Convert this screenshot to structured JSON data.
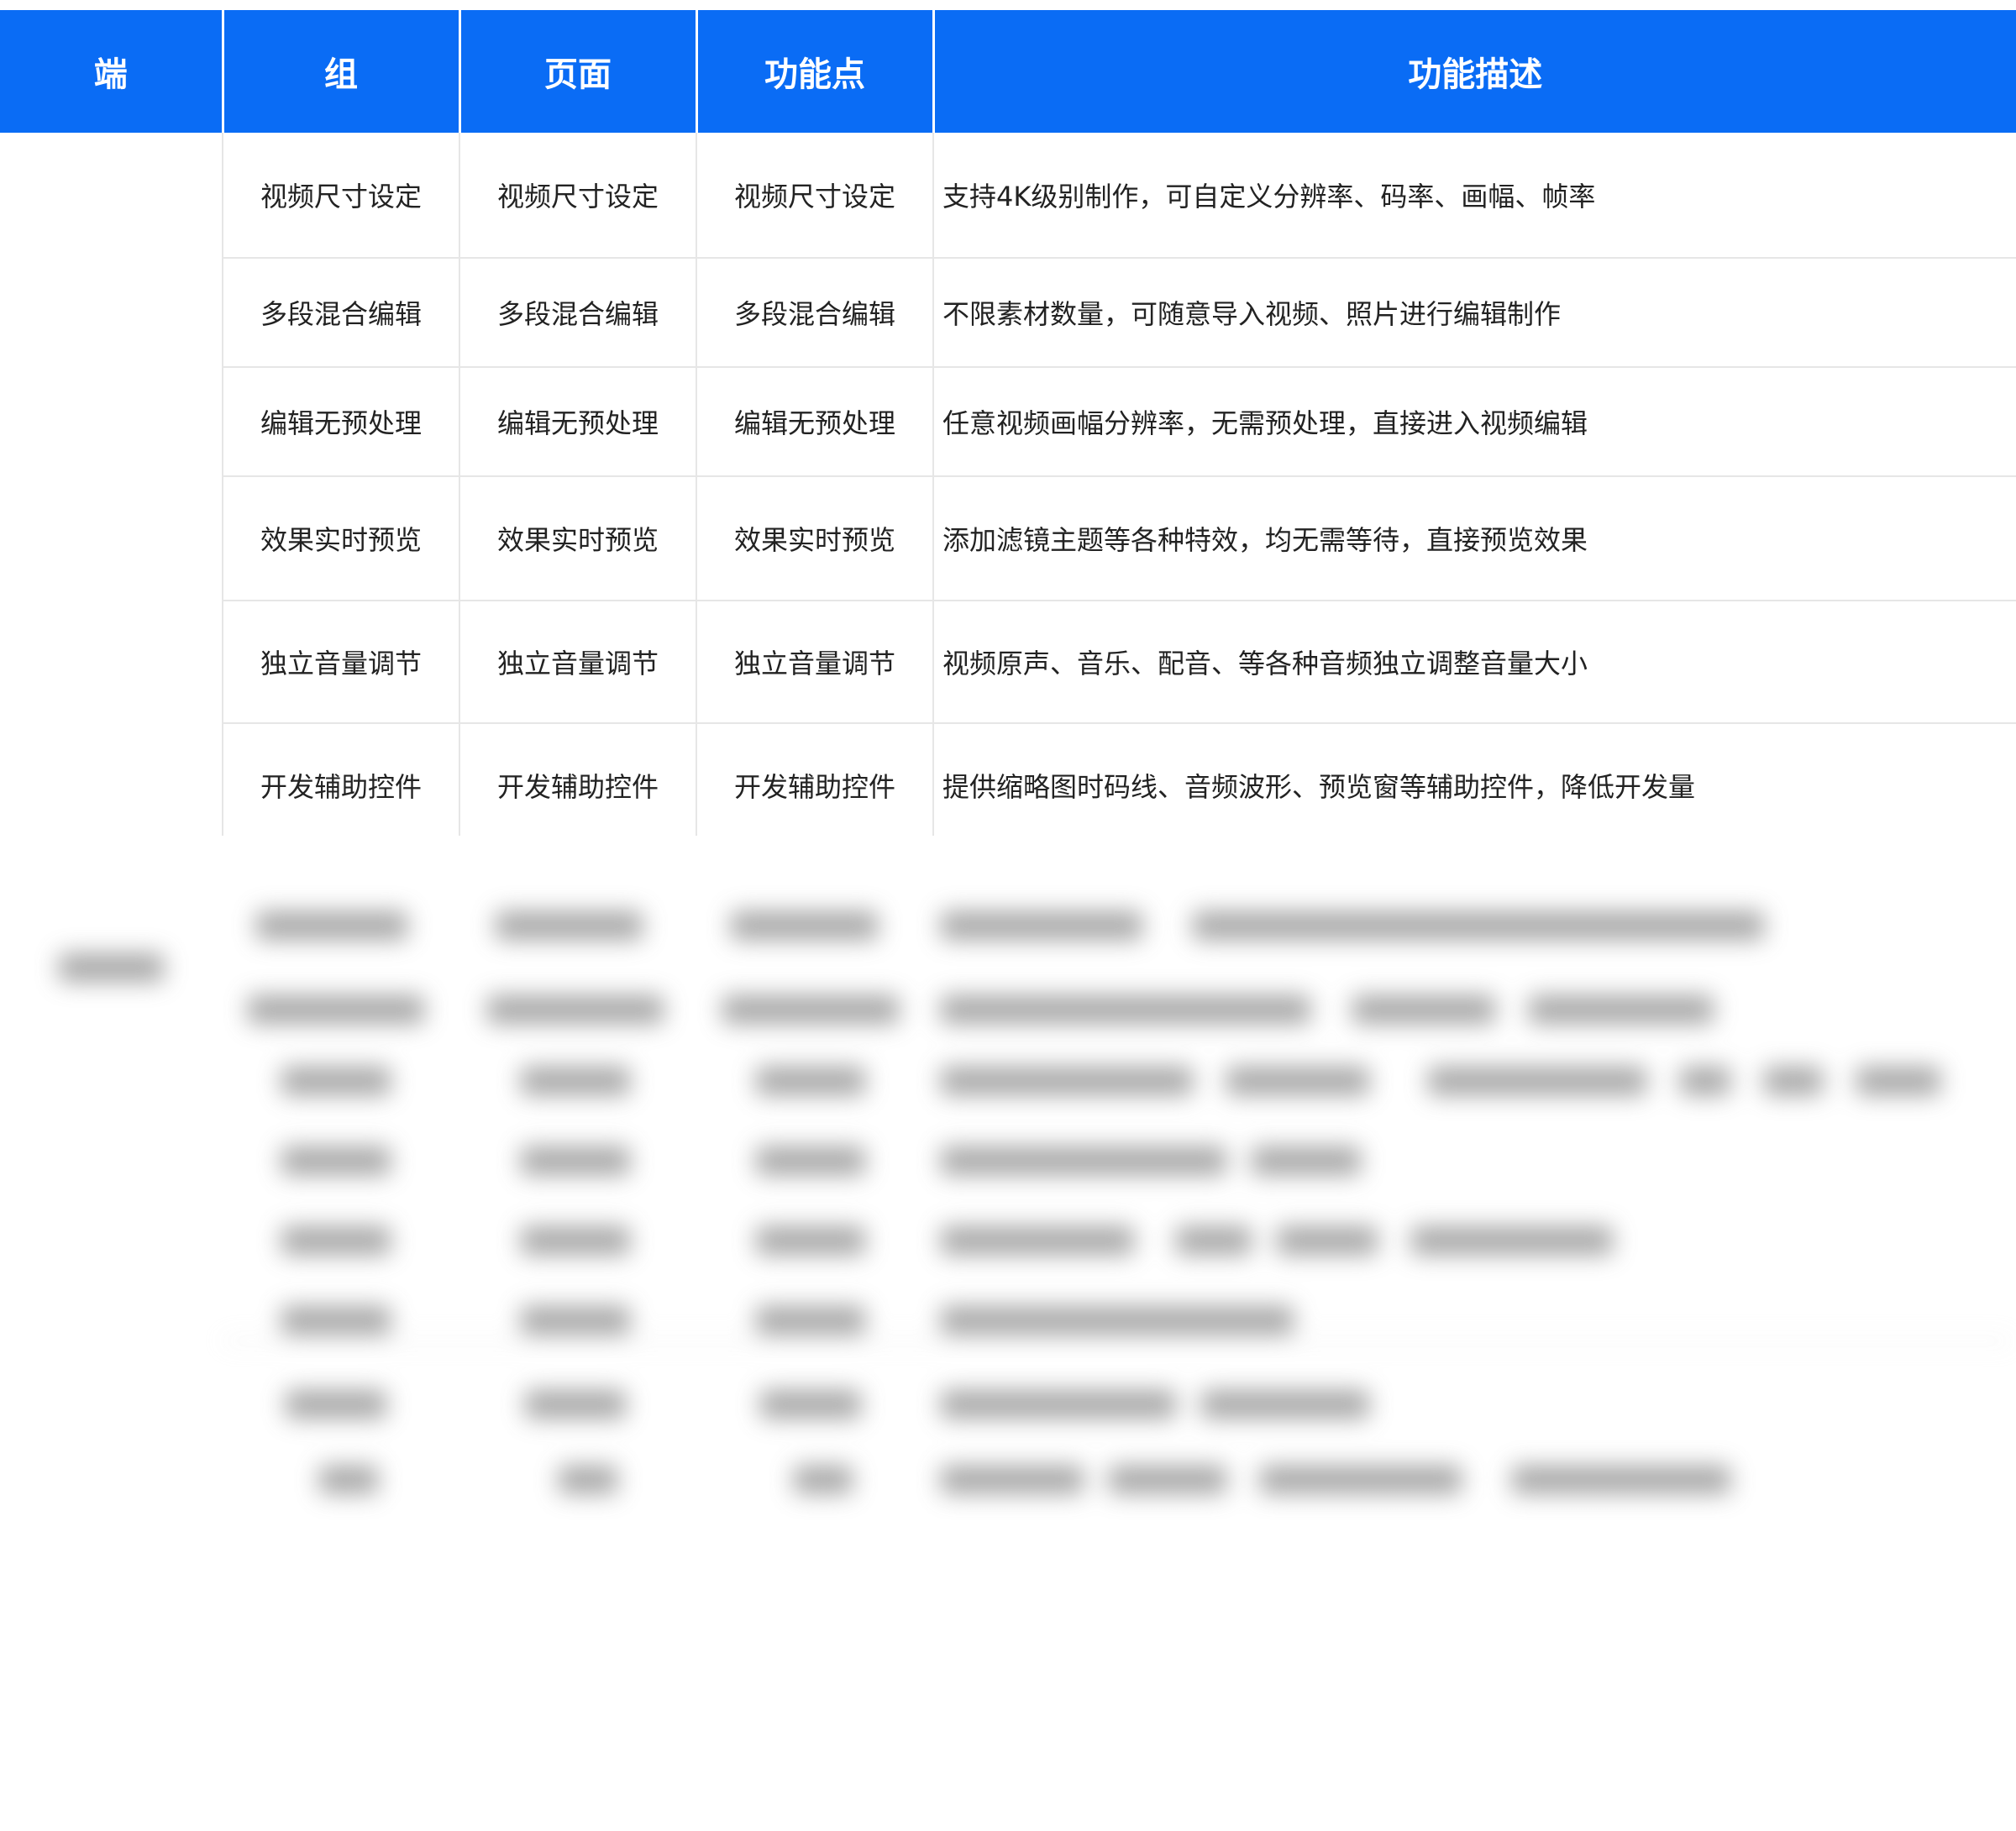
{
  "table": {
    "headers": {
      "duan": "端",
      "group": "组",
      "page": "页面",
      "feature": "功能点",
      "description": "功能描述"
    },
    "rows": [
      {
        "group": "视频尺寸设定",
        "page": "视频尺寸设定",
        "feature": "视频尺寸设定",
        "description": "支持4K级别制作，可自定义分辨率、码率、画幅、帧率"
      },
      {
        "group": "多段混合编辑",
        "page": "多段混合编辑",
        "feature": "多段混合编辑",
        "description": "不限素材数量，可随意导入视频、照片进行编辑制作"
      },
      {
        "group": "编辑无预处理",
        "page": "编辑无预处理",
        "feature": "编辑无预处理",
        "description": "任意视频画幅分辨率，无需预处理，直接进入视频编辑"
      },
      {
        "group": "效果实时预览",
        "page": "效果实时预览",
        "feature": "效果实时预览",
        "description": "添加滤镜主题等各种特效，均无需等待，直接预览效果"
      },
      {
        "group": "独立音量调节",
        "page": "独立音量调节",
        "feature": "独立音量调节",
        "description": "视频原声、音乐、配音、等各种音频独立调整音量大小"
      },
      {
        "group": "开发辅助控件",
        "page": "开发辅助控件",
        "feature": "开发辅助控件",
        "description": "提供缩略图时码线、音频波形、预览窗等辅助控件，降低开发量"
      }
    ]
  },
  "colors": {
    "header_bg": "#0a6cf5",
    "header_text": "#ffffff",
    "grid_line": "#e6e6e6",
    "body_text": "#222222"
  }
}
